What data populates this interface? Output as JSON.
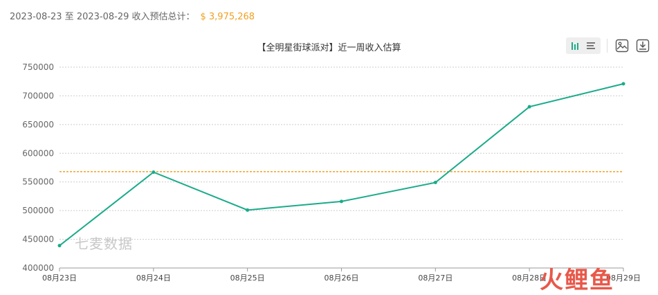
{
  "summary": {
    "range_text": "2023-08-23 至 2023-08-29 收入预估总计：",
    "total": "$ 3,975,268"
  },
  "colors": {
    "line": "#1aab8a",
    "average_line": "#f0a020",
    "grid": "#cccccc",
    "axis_text": "#666666"
  },
  "toolbar": {
    "icons": [
      "bar-chart-icon",
      "list-icon",
      "save-image-icon",
      "download-icon"
    ]
  },
  "watermark": "七麦数据",
  "logo": [
    "火",
    "鲤",
    "鱼"
  ],
  "chart_data": {
    "type": "line",
    "title": "【全明星街球派对】近一周收入估算",
    "xlabel": "",
    "ylabel": "",
    "categories": [
      "08月23日",
      "08月24日",
      "08月25日",
      "08月26日",
      "08月27日",
      "08月28日",
      "08月29日"
    ],
    "series": [
      {
        "values": [
          439000,
          567000,
          501000,
          516000,
          549000,
          681000,
          721000
        ]
      }
    ],
    "average_line": 567895,
    "ylim": [
      400000,
      750000
    ],
    "yticks": [
      400000,
      450000,
      500000,
      550000,
      600000,
      650000,
      700000,
      750000
    ],
    "grid": true,
    "legend": "none"
  }
}
